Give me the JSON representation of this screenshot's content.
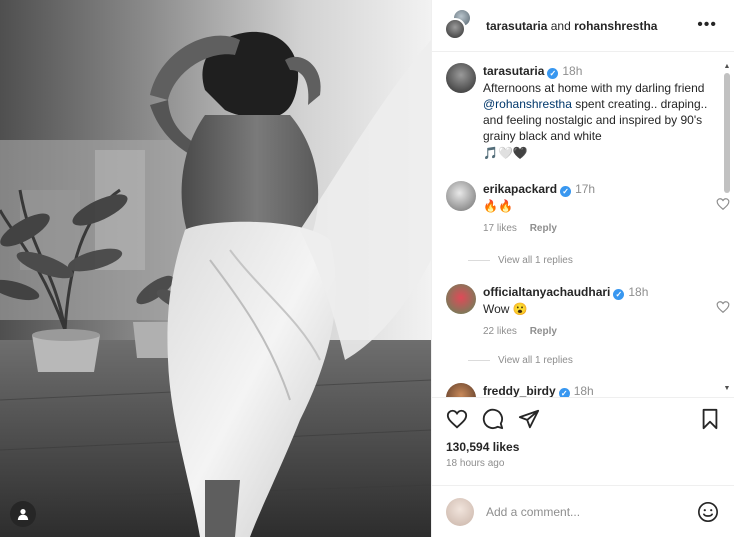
{
  "header": {
    "user1": "tarasutaria",
    "and": "and",
    "user2": "rohanshrestha",
    "more": "•••"
  },
  "caption": {
    "username": "tarasutaria",
    "time": "18h",
    "text_before": "Afternoons at home with my darling friend ",
    "mention": "@rohanshrestha",
    "text_after": " spent creating.. draping.. and feeling nostalgic and inspired by 90's grainy black and white",
    "emoji": "🎵🤍🖤"
  },
  "comments": [
    {
      "username": "erikapackard",
      "time": "17h",
      "text": "🔥🔥",
      "likes": "17 likes",
      "reply": "Reply",
      "view_replies": "View all 1 replies"
    },
    {
      "username": "officialtanyachaudhari",
      "time": "18h",
      "text": "Wow 😮",
      "likes": "22 likes",
      "reply": "Reply",
      "view_replies": "View all 1 replies"
    },
    {
      "username": "freddy_birdy",
      "time": "18h",
      "text": "",
      "likes": "",
      "reply": "",
      "view_replies": ""
    }
  ],
  "stats": {
    "likes": "130,594 likes",
    "posted": "18 hours ago"
  },
  "add_comment": {
    "placeholder": "Add a comment..."
  },
  "icons": {
    "like": "heart-icon",
    "comment": "comment-icon",
    "share": "share-icon",
    "save": "bookmark-icon",
    "emoji": "smiley-icon",
    "tag": "user-tag-icon"
  },
  "colors": {
    "verified": "#3897f0",
    "mention": "#00376b",
    "muted": "#8e8e8e"
  }
}
